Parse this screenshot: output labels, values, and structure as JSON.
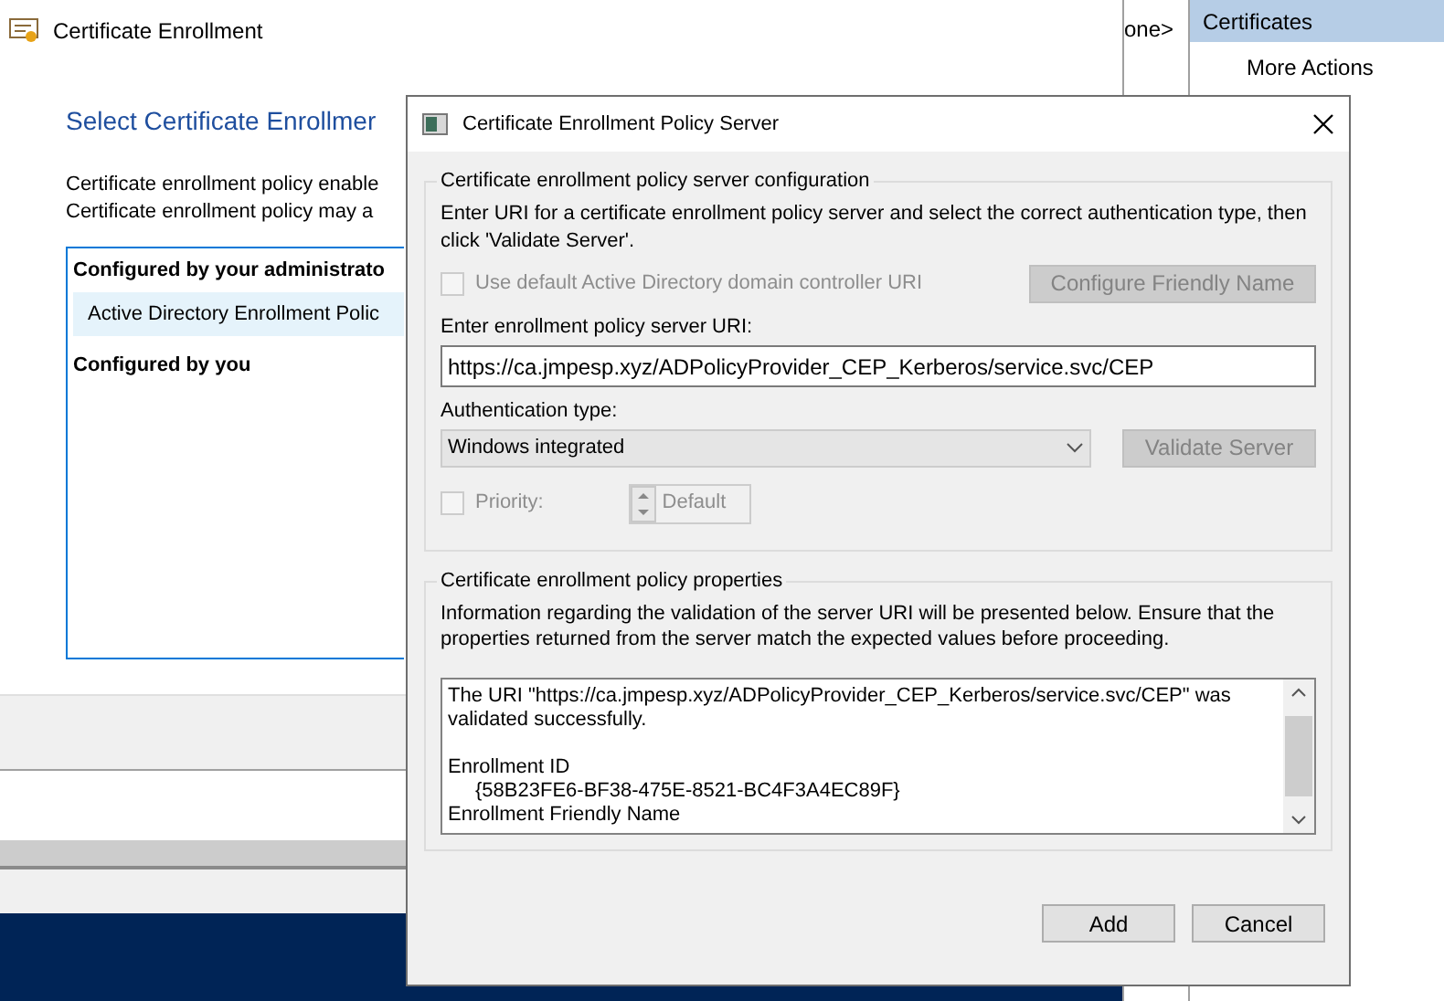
{
  "main_window": {
    "title": "Certificate Enrollment",
    "heading": "Select Certificate Enrollmer",
    "description": [
      "Certificate enrollment policy enable",
      "Certificate enrollment policy may a"
    ],
    "policy_groups": [
      {
        "label": "Configured by your administrato",
        "items": [
          {
            "label": "Active Directory Enrollment Polic",
            "selected": true
          }
        ]
      },
      {
        "label": "Configured by you"
      }
    ]
  },
  "console_column": {
    "text": "one>"
  },
  "actions_pane": {
    "header": "Certificates",
    "items": [
      "More Actions"
    ]
  },
  "dialog": {
    "title": "Certificate Enrollment Policy Server",
    "config_group": {
      "legend": "Certificate enrollment policy server configuration",
      "instructions": "Enter URI for a certificate enrollment policy server and select the correct authentication type, then click 'Validate Server'.",
      "use_default_checkbox": {
        "label": "Use default Active Directory domain controller URI",
        "checked": false,
        "disabled": true
      },
      "configure_friendly_name_button": {
        "label": "Configure Friendly Name",
        "disabled": true
      },
      "uri_label": "Enter enrollment policy server URI:",
      "uri_value": "https://ca.jmpesp.xyz/ADPolicyProvider_CEP_Kerberos/service.svc/CEP",
      "auth_label": "Authentication type:",
      "auth_value": "Windows integrated",
      "validate_button": {
        "label": "Validate Server",
        "disabled": true
      },
      "priority_checkbox": {
        "label": "Priority:",
        "checked": false,
        "disabled": true
      },
      "priority_spinner": {
        "value": "Default",
        "disabled": true
      }
    },
    "properties_group": {
      "legend": "Certificate enrollment policy properties",
      "info": "Information regarding the validation of the server URI will be presented below. Ensure that the properties returned from the server match the expected values before proceeding.",
      "output_lines": [
        {
          "kind": "message",
          "text": "The URI \"https://ca.jmpesp.xyz/ADPolicyProvider_CEP_Kerberos/service.svc/CEP\" was validated successfully."
        },
        {
          "kind": "field",
          "text": "Enrollment ID"
        },
        {
          "kind": "value",
          "text": "{58B23FE6-BF38-475E-8521-BC4F3A4EC89F}"
        },
        {
          "kind": "field",
          "text": "Enrollment Friendly Name"
        }
      ]
    },
    "buttons": [
      {
        "label": "Add"
      },
      {
        "label": "Cancel"
      }
    ]
  }
}
